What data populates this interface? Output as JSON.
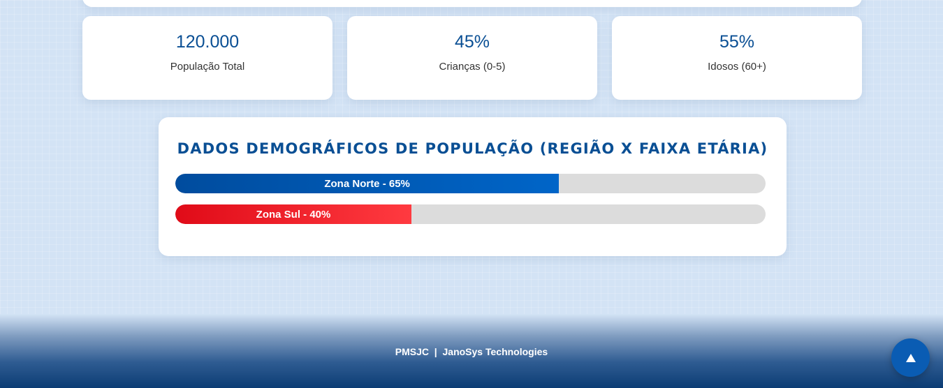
{
  "stats": [
    {
      "value": "120.000",
      "label": "População Total"
    },
    {
      "value": "45%",
      "label": "Crianças (0-5)"
    },
    {
      "value": "55%",
      "label": "Idosos (60+)"
    }
  ],
  "demographics": {
    "title": "DADOS DEMOGRÁFICOS DE POPULAÇÃO (REGIÃO X FAIXA ETÁRIA)",
    "bars": [
      {
        "label": "Zona Norte - 65%",
        "percent": 65,
        "color": "#0058b4"
      },
      {
        "label": "Zona Sul - 40%",
        "percent": 40,
        "color": "#f01c26"
      }
    ]
  },
  "footer": {
    "text": "PMSJC  |  JanoSys Technologies"
  },
  "scroll_top": {
    "icon": "arrow-up-icon"
  },
  "colors": {
    "primary": "#0a4f94",
    "accent_blue": "#0058b4",
    "accent_red": "#f01c26",
    "background": "#d3e3f5"
  }
}
